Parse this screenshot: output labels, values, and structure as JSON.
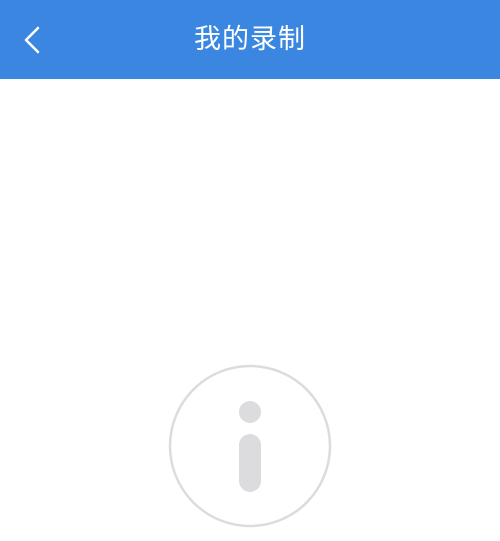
{
  "header": {
    "title": "我的录制",
    "back_icon": "chevron-left-icon",
    "background_color": "#3a86e0",
    "text_color": "#ffffff"
  },
  "empty_state": {
    "icon": "info-icon",
    "icon_color": "#dcdcde"
  }
}
